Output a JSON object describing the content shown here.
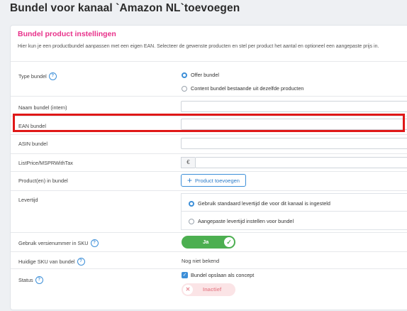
{
  "page": {
    "title": "Bundel voor kanaal `Amazon NL`toevoegen"
  },
  "card": {
    "title": "Bundel product instellingen",
    "description": "Hier kun je een productbundel aanpassen met een eigen EAN. Selecteer de gewenste producten en stel per product het aantal en optioneel een aangepaste prijs in."
  },
  "fields": {
    "type_bundel": {
      "label": "Type bundel",
      "options": [
        "Offer bundel",
        "Content bundel bestaande uit dezelfde producten"
      ],
      "selected": "Offer bundel"
    },
    "naam_bundel": {
      "label": "Naam bundel (intern)",
      "value": ""
    },
    "ean_bundel": {
      "label": "EAN bundel",
      "value": ""
    },
    "asin_bundel": {
      "label": "ASIN bundel",
      "value": ""
    },
    "listprice": {
      "label": "ListPrice/MSPRWithTax",
      "currency_symbol": "€",
      "value": ""
    },
    "producten": {
      "label": "Product(en) in bundel",
      "button_label": "Product toevoegen"
    },
    "levertijd": {
      "label": "Levertijd",
      "options": [
        "Gebruik standaard levertijd die voor dit kanaal is ingesteld",
        "Aangepaste levertijd instellen voor bundel"
      ],
      "selected": "Gebruik standaard levertijd die voor dit kanaal is ingesteld"
    },
    "versienummer": {
      "label": "Gebruik versienummer in SKU",
      "toggle_label": "Ja",
      "toggle_on": true
    },
    "huidige_sku": {
      "label": "Huidige SKU van bundel",
      "value": "Nog niet bekend"
    },
    "status": {
      "label": "Status",
      "checkbox_label": "Bundel opslaan als concept",
      "checked": true,
      "toggle_label": "Inactief",
      "toggle_on": false
    }
  },
  "colors": {
    "accent": "#e8318a",
    "primary": "#3d8fd8",
    "success": "#4caf50",
    "highlight": "#e01818"
  },
  "icons": {
    "help": "help-circle-icon",
    "add": "plus-icon",
    "check": "check-icon",
    "close": "close-icon"
  }
}
